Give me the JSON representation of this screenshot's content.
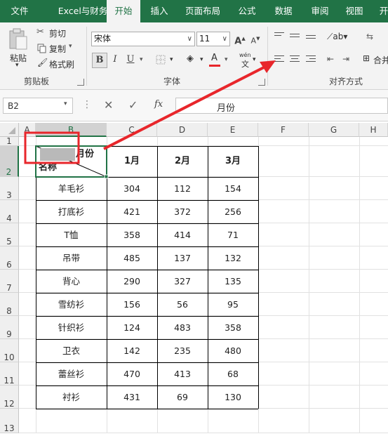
{
  "tabs": [
    "文件",
    "Excel与财务",
    "开始",
    "插入",
    "页面布局",
    "公式",
    "数据",
    "审阅",
    "视图",
    "开"
  ],
  "active_tab_index": 2,
  "clipboard": {
    "paste_label": "粘贴",
    "cut_label": "剪切",
    "copy_label": "复制",
    "format_painter_label": "格式刷",
    "group_label": "剪贴板"
  },
  "font": {
    "font_name": "宋体",
    "font_size": "11",
    "grow_label": "A",
    "shrink_label": "A",
    "bold_label": "B",
    "italic_label": "I",
    "underline_label": "U",
    "font_color_label": "A",
    "phonetic_label": "wén",
    "phonetic_sub": "文",
    "group_label": "字体"
  },
  "alignment": {
    "group_label": "对齐方式",
    "merge_label": "合并"
  },
  "formula_bar": {
    "name_box": "B2",
    "content": "月份",
    "fx_label": "fx"
  },
  "colors": {
    "brand": "#217346",
    "arrow": "#e8262b",
    "font_color_bar": "#e8262b"
  },
  "sheet": {
    "columns": [
      "A",
      "B",
      "C",
      "D",
      "E",
      "F",
      "G",
      "H"
    ],
    "rows": [
      "1",
      "2",
      "3",
      "4",
      "5",
      "6",
      "7",
      "8",
      "9",
      "10",
      "11",
      "12",
      "13"
    ],
    "selected_cell": "B2",
    "header_top": "月份",
    "header_bottom": "名称",
    "month_headers": [
      "1月",
      "2月",
      "3月"
    ],
    "data": [
      {
        "name": "羊毛衫",
        "values": [
          "304",
          "112",
          "154"
        ]
      },
      {
        "name": "打底衫",
        "values": [
          "421",
          "372",
          "256"
        ]
      },
      {
        "name": "T恤",
        "values": [
          "358",
          "414",
          "71"
        ]
      },
      {
        "name": "吊带",
        "values": [
          "485",
          "137",
          "132"
        ]
      },
      {
        "name": "背心",
        "values": [
          "290",
          "327",
          "135"
        ]
      },
      {
        "name": "雪纺衫",
        "values": [
          "156",
          "56",
          "95"
        ]
      },
      {
        "name": "针织衫",
        "values": [
          "124",
          "483",
          "358"
        ]
      },
      {
        "name": "卫衣",
        "values": [
          "142",
          "235",
          "480"
        ]
      },
      {
        "name": "蕾丝衫",
        "values": [
          "470",
          "413",
          "68"
        ]
      },
      {
        "name": "衬衫",
        "values": [
          "431",
          "69",
          "130"
        ]
      }
    ]
  }
}
